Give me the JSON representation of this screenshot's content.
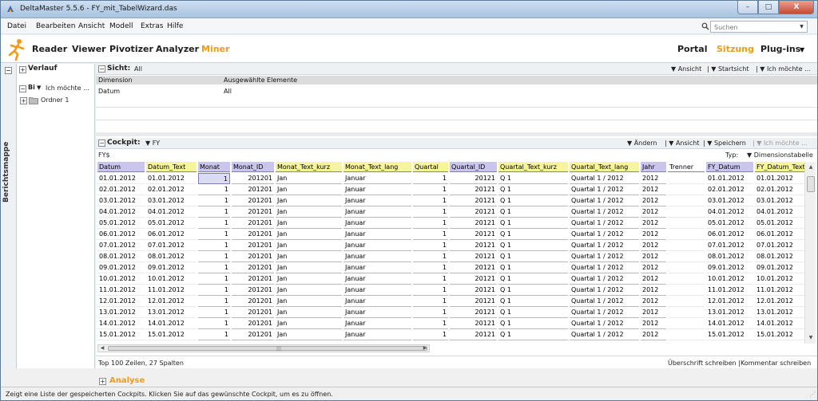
{
  "window": {
    "title": "DeltaMaster 5.5.6 - FY_mit_TabelWizard.das",
    "buttons": [
      "–",
      "□",
      "X"
    ]
  },
  "menu": [
    "Datei",
    "Bearbeiten",
    "Ansicht",
    "Modell",
    "Extras",
    "Hilfe"
  ],
  "search": {
    "placeholder": "Suchen"
  },
  "ribbon": {
    "left_tabs": [
      "Reader",
      "Viewer",
      "Pivotizer",
      "Analyzer",
      "Miner"
    ],
    "active_left": "Miner",
    "right_tabs": [
      "Portal",
      "Sitzung",
      "Plug-ins"
    ],
    "active_right": "Sitzung"
  },
  "sidestrip": {
    "label": "Berichtsmappe"
  },
  "leftpanel": {
    "verlauf": "Verlauf",
    "bi": "Bi",
    "ich": "Ich möchte ...",
    "ordner": "Ordner 1"
  },
  "sicht": {
    "title": "Sicht:",
    "value": "All",
    "tools": [
      "Ansicht",
      "Startsicht",
      "Ich möchte ..."
    ],
    "col1": "Dimension",
    "col2": "Ausgewählte Elemente",
    "row_dim": "Datum",
    "row_sel": "All"
  },
  "cockpit": {
    "title": "Cockpit:",
    "value": "FY",
    "tools": [
      "Ändern",
      "Ansicht",
      "Speichern",
      "Ich möchte ..."
    ],
    "sub": "FY$",
    "typ_label": "Typ:",
    "typ_value": "Dimensionstabelle"
  },
  "grid": {
    "columns": [
      {
        "label": "Datum",
        "color": "#c9c5ec"
      },
      {
        "label": "Datum_Text",
        "color": "#f6f59a"
      },
      {
        "label": "Monat",
        "color": "#c9c5ec"
      },
      {
        "label": "Monat_ID",
        "color": "#c9c5ec"
      },
      {
        "label": "Monat_Text_kurz",
        "color": "#f6f59a"
      },
      {
        "label": "Monat_Text_lang",
        "color": "#f6f59a"
      },
      {
        "label": "Quartal",
        "color": "#f6f59a"
      },
      {
        "label": "Quartal_ID",
        "color": "#c9c5ec"
      },
      {
        "label": "Quartal_Text_kurz",
        "color": "#f6f59a"
      },
      {
        "label": "Quartal_Text_lang",
        "color": "#f6f59a"
      },
      {
        "label": "Jahr",
        "color": "#c9c5ec"
      },
      {
        "label": "Trenner",
        "color": "#ffffff"
      },
      {
        "label": "FY_Datum",
        "color": "#c9c5ec"
      },
      {
        "label": "FY_Datum_Text",
        "color": "#f6f59a"
      }
    ],
    "rows": [
      [
        "01.01.2012",
        "01.01.2012",
        "1",
        "201201",
        "Jan",
        "Januar",
        "1",
        "20121",
        "Q 1",
        "Quartal 1 / 2012",
        "2012",
        "",
        "01.01.2012",
        "01.01.2012"
      ],
      [
        "02.01.2012",
        "02.01.2012",
        "1",
        "201201",
        "Jan",
        "Januar",
        "1",
        "20121",
        "Q 1",
        "Quartal 1 / 2012",
        "2012",
        "",
        "02.01.2012",
        "02.01.2012"
      ],
      [
        "03.01.2012",
        "03.01.2012",
        "1",
        "201201",
        "Jan",
        "Januar",
        "1",
        "20121",
        "Q 1",
        "Quartal 1 / 2012",
        "2012",
        "",
        "03.01.2012",
        "03.01.2012"
      ],
      [
        "04.01.2012",
        "04.01.2012",
        "1",
        "201201",
        "Jan",
        "Januar",
        "1",
        "20121",
        "Q 1",
        "Quartal 1 / 2012",
        "2012",
        "",
        "04.01.2012",
        "04.01.2012"
      ],
      [
        "05.01.2012",
        "05.01.2012",
        "1",
        "201201",
        "Jan",
        "Januar",
        "1",
        "20121",
        "Q 1",
        "Quartal 1 / 2012",
        "2012",
        "",
        "05.01.2012",
        "05.01.2012"
      ],
      [
        "06.01.2012",
        "06.01.2012",
        "1",
        "201201",
        "Jan",
        "Januar",
        "1",
        "20121",
        "Q 1",
        "Quartal 1 / 2012",
        "2012",
        "",
        "06.01.2012",
        "06.01.2012"
      ],
      [
        "07.01.2012",
        "07.01.2012",
        "1",
        "201201",
        "Jan",
        "Januar",
        "1",
        "20121",
        "Q 1",
        "Quartal 1 / 2012",
        "2012",
        "",
        "07.01.2012",
        "07.01.2012"
      ],
      [
        "08.01.2012",
        "08.01.2012",
        "1",
        "201201",
        "Jan",
        "Januar",
        "1",
        "20121",
        "Q 1",
        "Quartal 1 / 2012",
        "2012",
        "",
        "08.01.2012",
        "08.01.2012"
      ],
      [
        "09.01.2012",
        "09.01.2012",
        "1",
        "201201",
        "Jan",
        "Januar",
        "1",
        "20121",
        "Q 1",
        "Quartal 1 / 2012",
        "2012",
        "",
        "09.01.2012",
        "09.01.2012"
      ],
      [
        "10.01.2012",
        "10.01.2012",
        "1",
        "201201",
        "Jan",
        "Januar",
        "1",
        "20121",
        "Q 1",
        "Quartal 1 / 2012",
        "2012",
        "",
        "10.01.2012",
        "10.01.2012"
      ],
      [
        "11.01.2012",
        "11.01.2012",
        "1",
        "201201",
        "Jan",
        "Januar",
        "1",
        "20121",
        "Q 1",
        "Quartal 1 / 2012",
        "2012",
        "",
        "11.01.2012",
        "11.01.2012"
      ],
      [
        "12.01.2012",
        "12.01.2012",
        "1",
        "201201",
        "Jan",
        "Januar",
        "1",
        "20121",
        "Q 1",
        "Quartal 1 / 2012",
        "2012",
        "",
        "12.01.2012",
        "12.01.2012"
      ],
      [
        "13.01.2012",
        "13.01.2012",
        "1",
        "201201",
        "Jan",
        "Januar",
        "1",
        "20121",
        "Q 1",
        "Quartal 1 / 2012",
        "2012",
        "",
        "13.01.2012",
        "13.01.2012"
      ],
      [
        "14.01.2012",
        "14.01.2012",
        "1",
        "201201",
        "Jan",
        "Januar",
        "1",
        "20121",
        "Q 1",
        "Quartal 1 / 2012",
        "2012",
        "",
        "14.01.2012",
        "14.01.2012"
      ],
      [
        "15.01.2012",
        "15.01.2012",
        "1",
        "201201",
        "Jan",
        "Januar",
        "1",
        "20121",
        "Q 1",
        "Quartal 1 / 2012",
        "2012",
        "",
        "15.01.2012",
        "15.01.2012"
      ]
    ],
    "status": "Top 100 Zeilen, 27 Spalten",
    "uberschrift": "Überschrift schreiben",
    "kommentar": "Kommentar schreiben"
  },
  "analyse": {
    "label": "Analyse"
  },
  "statusbar": {
    "text": "Zeigt eine Liste der gespeicherten Cockpits. Klicken Sie auf das gewünschte Cockpit, um es zu öffnen."
  },
  "colors": {
    "accent": "#f39a18",
    "key_header": "#c9c5ec",
    "text_header": "#f6f59a",
    "selected_cell": "#d9dcf2"
  },
  "icons": [
    "app-icon",
    "search-icon",
    "deltamaster-logo",
    "folder-icon",
    "chevron-down-icon",
    "plus-icon",
    "minus-icon"
  ]
}
